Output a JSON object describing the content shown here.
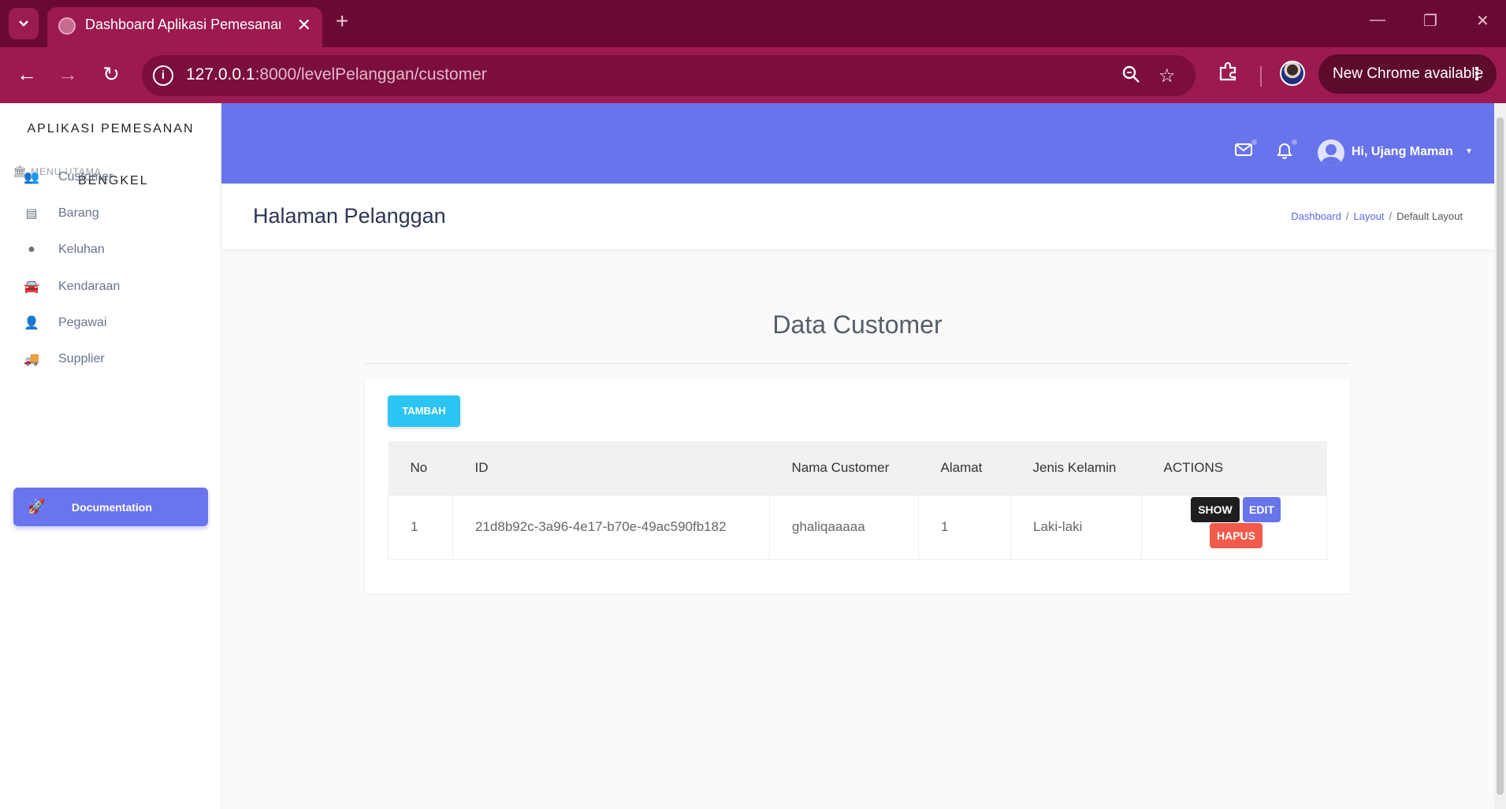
{
  "browser": {
    "tab_title": "Dashboard Aplikasi Pemesanan",
    "url_host": "127.0.0.1",
    "url_rest": ":8000/levelPelanggan/customer",
    "chrome_update": "New Chrome available"
  },
  "sidebar": {
    "brand": "APLIKASI PEMESANAN",
    "brand_sub": "BENGKEL",
    "menu_heading": "MENU UTAMA",
    "items": [
      {
        "label": "Customer",
        "icon": "users-icon"
      },
      {
        "label": "Barang",
        "icon": "box-icon"
      },
      {
        "label": "Keluhan",
        "icon": "exclamation-icon"
      },
      {
        "label": "Kendaraan",
        "icon": "car-icon"
      },
      {
        "label": "Pegawai",
        "icon": "user-icon"
      },
      {
        "label": "Supplier",
        "icon": "truck-icon"
      }
    ],
    "doc_button": "Documentation"
  },
  "topbar": {
    "user_greeting": "Hi, Ujang Maman"
  },
  "header": {
    "title": "Halaman Pelanggan",
    "breadcrumb": [
      "Dashboard",
      "Layout",
      "Default Layout"
    ]
  },
  "main": {
    "section_title": "Data Customer",
    "add_button": "TAMBAH",
    "table": {
      "headers": [
        "No",
        "ID",
        "Nama Customer",
        "Alamat",
        "Jenis Kelamin",
        "ACTIONS"
      ],
      "rows": [
        {
          "no": "1",
          "id": "21d8b92c-3a96-4e17-b70e-49ac590fb182",
          "nama": "ghaliqaaaaa",
          "alamat": "1",
          "jenis_kelamin": "Laki-laki",
          "actions": {
            "show": "SHOW",
            "edit": "EDIT",
            "hapus": "HAPUS"
          }
        }
      ]
    }
  },
  "colors": {
    "browser_frame": "#9c1a4f",
    "topbar": "#6874ec",
    "add_button": "#2cc4f2",
    "show_button": "#1e1e1e",
    "edit_button": "#6874ec",
    "delete_button": "#f25a4a"
  }
}
